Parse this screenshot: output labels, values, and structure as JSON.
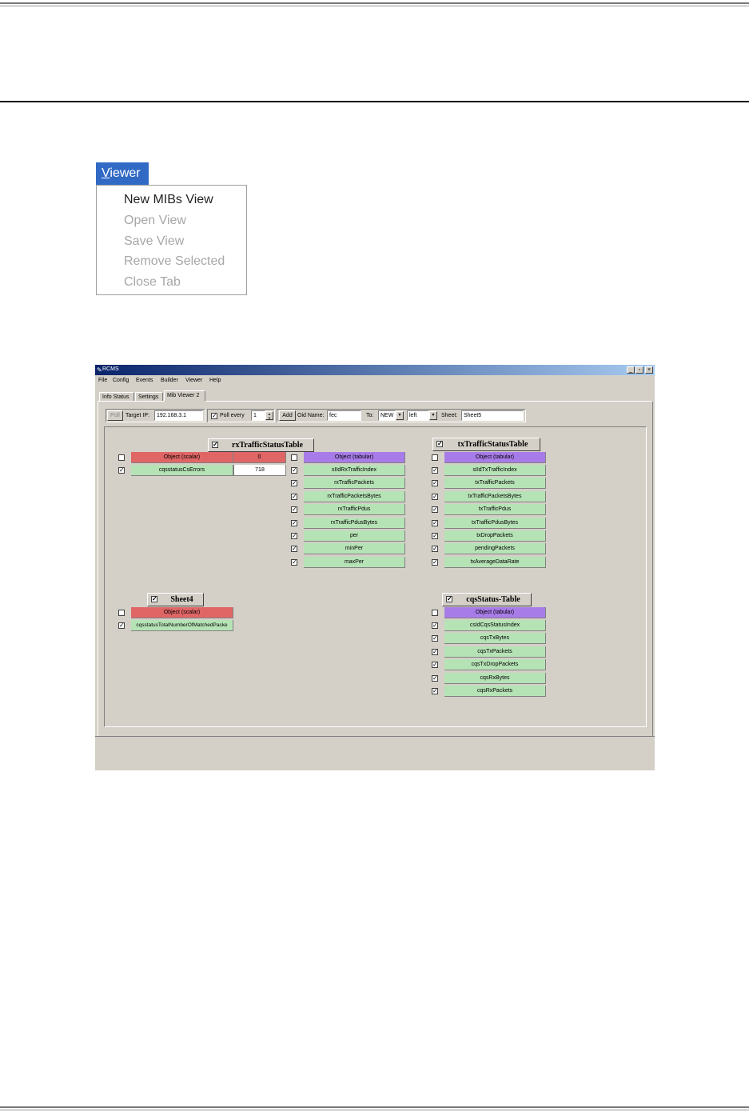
{
  "viewer_menu": {
    "title_first": "V",
    "title_rest": "iewer",
    "items": [
      {
        "label": "New MIBs View",
        "enabled": true
      },
      {
        "label": "Open View",
        "enabled": false
      },
      {
        "label": "Save View",
        "enabled": false
      },
      {
        "label": "Remove Selected",
        "enabled": false
      },
      {
        "label": "Close Tab",
        "enabled": false
      }
    ]
  },
  "app": {
    "title": "RCMS",
    "window_buttons": {
      "minimize": "_",
      "maximize": "▫",
      "close": "×"
    },
    "menubar": [
      "File",
      "Config",
      "Events",
      "Builder",
      "Viewer",
      "Help"
    ],
    "tabs": [
      "Info Status",
      "Settings",
      "Mib Viewer 2"
    ],
    "toolbar": {
      "poll_label": "Poll",
      "target_ip_label": "Target IP:",
      "target_ip_value": "192.168.3.1",
      "poll_every_label": "Poll every",
      "poll_every_value": "1",
      "add_label": "Add",
      "oid_name_label": "Oid Name:",
      "oid_name_value": "fec",
      "to_label": "To:",
      "to_value": "NEW",
      "position_value": "left",
      "sheet_label": "Sheet:",
      "sheet_value": "Sheet5"
    },
    "tables": {
      "rx": {
        "title": "rxTrafficStatusTable",
        "scalar_header": "Object (scalar)",
        "scalar_header_value": "0",
        "scalar_row": {
          "name": "cqsstatusCsErrors",
          "value": "718"
        },
        "tabular_header": "Object (tabular)",
        "tabular_rows": [
          "sIIdRxTrafficIndex",
          "rxTrafficPackets",
          "rxTrafficPacketsBytes",
          "rxTrafficPdus",
          "rxTrafficPdusBytes",
          "per",
          "minPer",
          "maxPer"
        ]
      },
      "tx": {
        "title": "txTrafficStatusTable",
        "tabular_header": "Object (tabular)",
        "tabular_rows": [
          "sIIdTxTrafficIndex",
          "txTrafficPackets",
          "txTrafficPacketsBytes",
          "txTrafficPdus",
          "txTrafficPdusBytes",
          "txDropPackets",
          "pendingPackets",
          "txAverageDataRate"
        ]
      },
      "sheet4": {
        "title": "Sheet4",
        "scalar_header": "Object (scalar)",
        "row": "cqsstatusTotalNumberOfMatchedPacke"
      },
      "cqs": {
        "title": "cqsStatus-Table",
        "tabular_header": "Object (tabular)",
        "tabular_rows": [
          "csIdCqsStatusIndex",
          "cqsTxBytes",
          "cqsTxPackets",
          "cqsTxDropPackets",
          "cqsRxBytes",
          "cqsRxPackets"
        ]
      }
    }
  }
}
